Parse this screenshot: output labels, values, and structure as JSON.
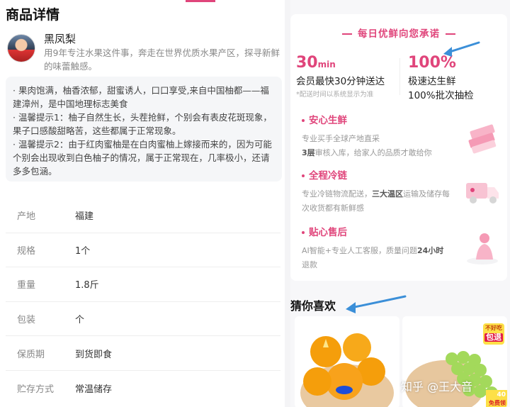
{
  "section_title": "商品详情",
  "seller": {
    "name": "黑凤梨",
    "desc": "用9年专注水果这件事，奔走在世界优质水果产区，探寻新鲜的味蕾触感。"
  },
  "notice": [
    "· 果肉饱满，柚香浓郁，甜蜜诱人，口口享受,来自中国柚都——福建漳州，是中国地理标志美食",
    "· 温馨提示1：柚子自然生长，头茬抢鲜，个别会有表皮花斑现象，果子口感酸甜略苦，这些都属于正常现象。",
    "· 温馨提示2：由于红肉蜜柚是在白肉蜜柚上嫁接而来的，因为可能个别会出现收到白色柚子的情况，属于正常现在，几率极小，还请多多包涵。"
  ],
  "specs": [
    {
      "key": "产地",
      "value": "福建"
    },
    {
      "key": "规格",
      "value": "1个"
    },
    {
      "key": "重量",
      "value": "1.8斤"
    },
    {
      "key": "包装",
      "value": "个"
    },
    {
      "key": "保质期",
      "value": "到货即食"
    },
    {
      "key": "贮存方式",
      "value": "常温储存"
    }
  ],
  "promise": {
    "title": "每日优鲜向您承诺",
    "stat1": {
      "big": "30",
      "unit": "min",
      "line": "会员最快30分钟送达",
      "note": "*配送时间以系统显示为准"
    },
    "stat2": {
      "big": "100%",
      "line1": "极速达生鲜",
      "line2": "100%批次抽检"
    },
    "features": [
      {
        "title": "安心生鲜",
        "desc_pre": "专业买手全球产地直采",
        "desc_bold": "3层",
        "desc_post": "审核入库，给家人的品质才敢给你",
        "icon": "boxes-icon"
      },
      {
        "title": "全程冷链",
        "desc_pre": "专业冷链物流配送，",
        "desc_bold": "三大温区",
        "desc_post": "运输及储存每次收货都有新鲜感",
        "icon": "truck-icon"
      },
      {
        "title": "贴心售后",
        "desc_pre": "AI智能+专业人工客服，质量问题",
        "desc_bold": "24小时",
        "desc_post": "退款",
        "icon": "agent-icon"
      }
    ]
  },
  "guess_title": "猜你喜欢",
  "badge": {
    "top": "不好吃",
    "big": "包退"
  },
  "badge2": {
    "corner": "免费领",
    "num": "40"
  },
  "watermark": "知乎 @王大音",
  "colors": {
    "accent": "#e0457b",
    "arrow": "#3b8fd8"
  }
}
